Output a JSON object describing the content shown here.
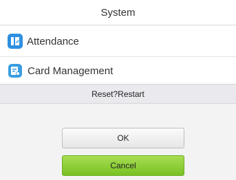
{
  "header": {
    "title": "System"
  },
  "menu": {
    "items": [
      {
        "label": "Attendance",
        "icon": "attendance-icon"
      },
      {
        "label": "Card Management",
        "icon": "card-management-icon"
      }
    ]
  },
  "dialog": {
    "message": "Reset?Restart",
    "ok_label": "OK",
    "cancel_label": "Cancel"
  },
  "colors": {
    "icon_blue": "#2e8fe0",
    "cancel_green": "#86cc33",
    "dialog_bg": "#f3f3f3"
  }
}
